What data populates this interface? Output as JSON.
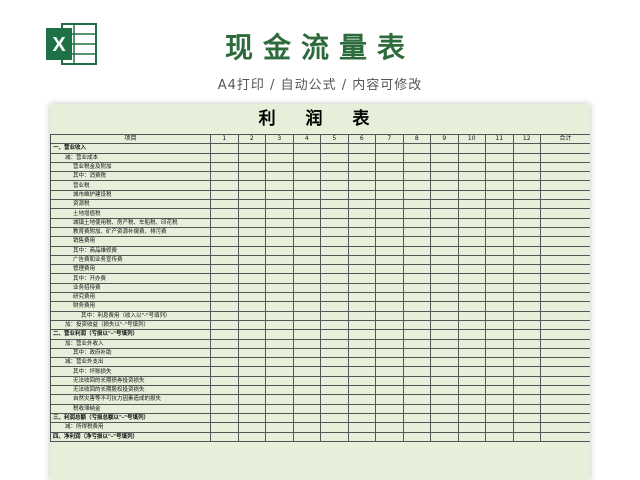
{
  "header": {
    "title": "现金流量表",
    "subtitle": "A4打印 / 自动公式 / 内容可修改",
    "logo_icon": "excel-icon",
    "logo_letter": "X",
    "accent_color": "#2e6b3c"
  },
  "sheet": {
    "title": "利 润 表",
    "background_color": "#e6efd9",
    "columns": [
      "项目",
      "1",
      "2",
      "3",
      "4",
      "5",
      "6",
      "7",
      "8",
      "9",
      "10",
      "11",
      "12",
      "合计"
    ],
    "rows": [
      {
        "label": "一、营业收入",
        "level": 0
      },
      {
        "label": "减：营业成本",
        "level": 1
      },
      {
        "label": "营业税金及附加",
        "level": 2
      },
      {
        "label": "其中：消费税",
        "level": 2
      },
      {
        "label": "营业税",
        "level": 2
      },
      {
        "label": "城市维护建设税",
        "level": 2
      },
      {
        "label": "资源税",
        "level": 2
      },
      {
        "label": "土地增值税",
        "level": 2
      },
      {
        "label": "城镇土地使用税、房产税、车船税、印花税",
        "level": 2
      },
      {
        "label": "教育费附加、矿产资源补偿费、排污费",
        "level": 2
      },
      {
        "label": "销售费用",
        "level": 2
      },
      {
        "label": "其中：商品维修费",
        "level": 2
      },
      {
        "label": "广告费和业务宣传费",
        "level": 2
      },
      {
        "label": "管理费用",
        "level": 2
      },
      {
        "label": "其中：开办费",
        "level": 2
      },
      {
        "label": "业务招待费",
        "level": 2
      },
      {
        "label": "研究费用",
        "level": 2
      },
      {
        "label": "财务费用",
        "level": 2
      },
      {
        "label": "其中：利息费用（收入以\"-\"号填列）",
        "level": 3
      },
      {
        "label": "加：投资收益（损失以\"-\"号填列）",
        "level": 1
      },
      {
        "label": "二、营业利润（亏损以\"-\"号填列）",
        "level": 0
      },
      {
        "label": "加：营业外收入",
        "level": 1
      },
      {
        "label": "其中：政府补助",
        "level": 2
      },
      {
        "label": "减：营业外支出",
        "level": 1
      },
      {
        "label": "其中：坏账损失",
        "level": 2
      },
      {
        "label": "无法收回的长期债券投资损失",
        "level": 2
      },
      {
        "label": "无法收回的长期股权投资损失",
        "level": 2
      },
      {
        "label": "自然灾害等不可抗力因素造成的损失",
        "level": 2
      },
      {
        "label": "税收滞纳金",
        "level": 2
      },
      {
        "label": "三、利润总额（亏损总额以\"-\"号填列）",
        "level": 0
      },
      {
        "label": "减：所得税费用",
        "level": 1
      },
      {
        "label": "四、净利润（净亏损以\"-\"号填列）",
        "level": 0
      }
    ]
  }
}
